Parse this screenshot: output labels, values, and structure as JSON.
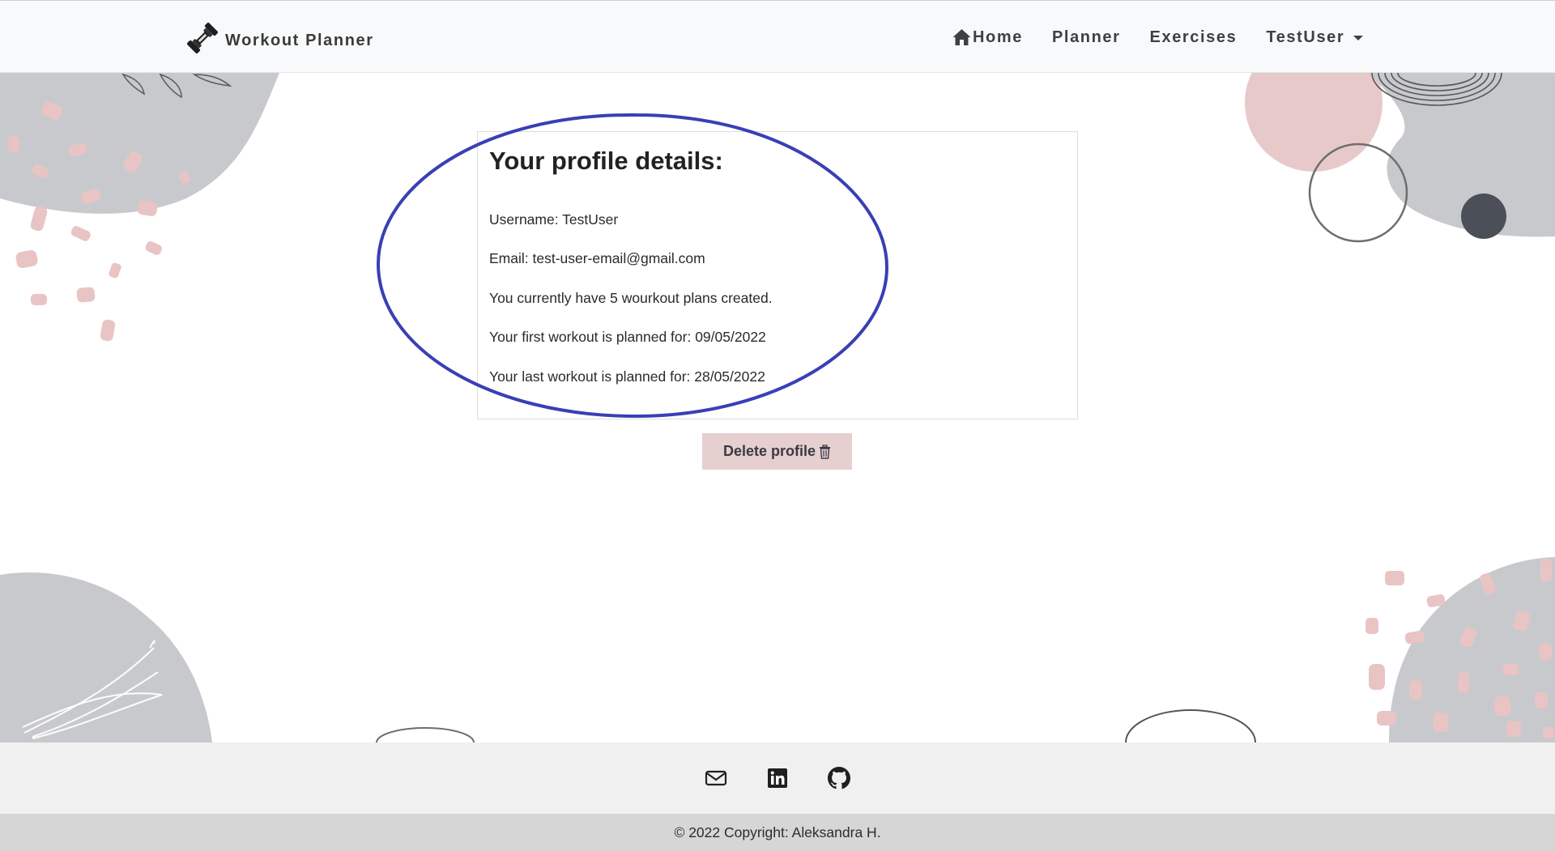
{
  "navbar": {
    "brand": "Workout Planner",
    "brand_icon": "dumbbell-icon",
    "links": [
      {
        "label": "Home",
        "icon": "home-icon"
      },
      {
        "label": "Planner"
      },
      {
        "label": "Exercises"
      },
      {
        "label": "TestUser",
        "icon": "caret-down-icon"
      }
    ]
  },
  "profile": {
    "title": "Your profile details:",
    "username": "Username: TestUser",
    "email": "Email: test-user-email@gmail.com",
    "plans": "You currently have 5 wourkout plans created.",
    "first_workout": "Your first workout is planned for: 09/05/2022",
    "last_workout": "Your last workout is planned for: 28/05/2022"
  },
  "delete_button": {
    "label": "Delete profile",
    "icon": "trash-icon"
  },
  "annotation": {
    "color": "#3a3fb5"
  },
  "footer": {
    "icons": [
      "envelope-icon",
      "linkedin-icon",
      "github-icon"
    ],
    "copyright": "© 2022 Copyright: Aleksandra H."
  },
  "colors": {
    "navbar_bg": "#f8f9fa",
    "button_bg": "#e6cfcf",
    "blob_gray": "#c8c9cd",
    "blob_pink": "#e7c9c9",
    "footer_bg": "#f0f0f0",
    "copyright_bg": "#d6d6d6"
  }
}
